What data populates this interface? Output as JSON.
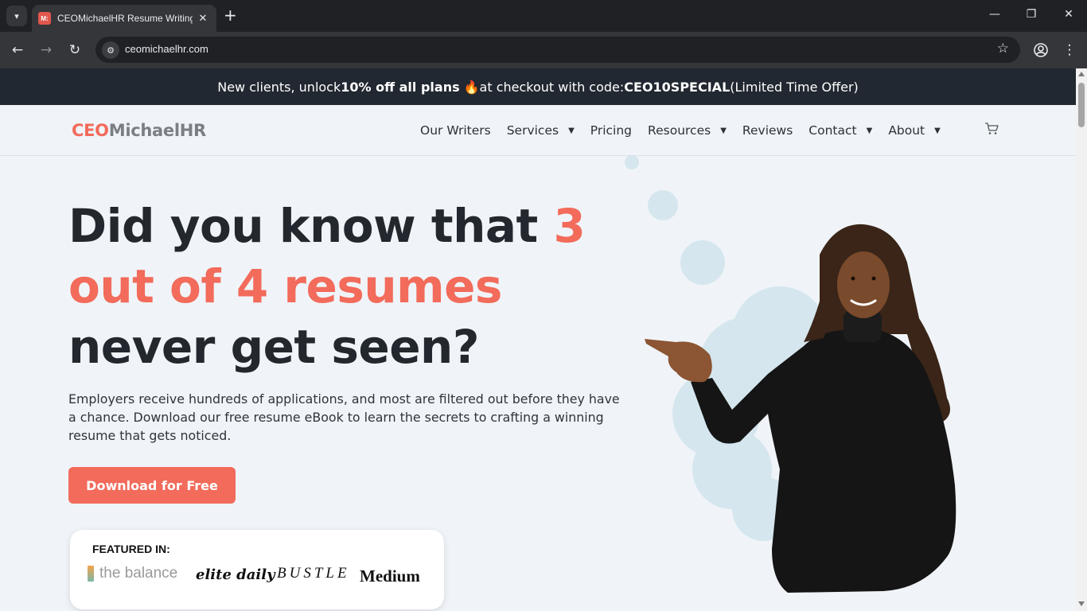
{
  "browser": {
    "tab_title": "CEOMichaelHR Resume Writing",
    "favicon_text": "M:",
    "url": "ceomichaelhr.com"
  },
  "promo": {
    "prefix": "New clients, unlock ",
    "bold_offer": "10% off all plans",
    "emoji": "🔥",
    "middle": " at checkout with code: ",
    "code": "CEO10SPECIAL",
    "suffix": " (Limited Time Offer)"
  },
  "header": {
    "logo_ceo": "CEO",
    "logo_rest": "MichaelHR",
    "nav": [
      {
        "label": "Our Writers",
        "dropdown": false
      },
      {
        "label": "Services",
        "dropdown": true
      },
      {
        "label": "Pricing",
        "dropdown": false
      },
      {
        "label": "Resources",
        "dropdown": true
      },
      {
        "label": "Reviews",
        "dropdown": false
      },
      {
        "label": "Contact",
        "dropdown": true
      },
      {
        "label": "About",
        "dropdown": true
      }
    ],
    "cart_icon": "cart-icon"
  },
  "hero": {
    "title_part1": "Did you know that ",
    "title_highlight": "3 out of 4 resumes",
    "title_part2": " never get seen?",
    "description": "Employers receive hundreds of applications, and most are filtered out before they have a chance. Download our free resume eBook to learn the secrets to crafting a winning resume that gets noticed.",
    "cta_label": "Download for Free"
  },
  "featured": {
    "label": "FEATURED IN:",
    "publications": [
      "the balance",
      "elite daily",
      "BUSTLE",
      "Medium"
    ]
  },
  "colors": {
    "accent": "#f26b5b",
    "promo_bg": "#222831",
    "page_bg": "#f0f4f8",
    "bubble": "#d5e6ee"
  }
}
